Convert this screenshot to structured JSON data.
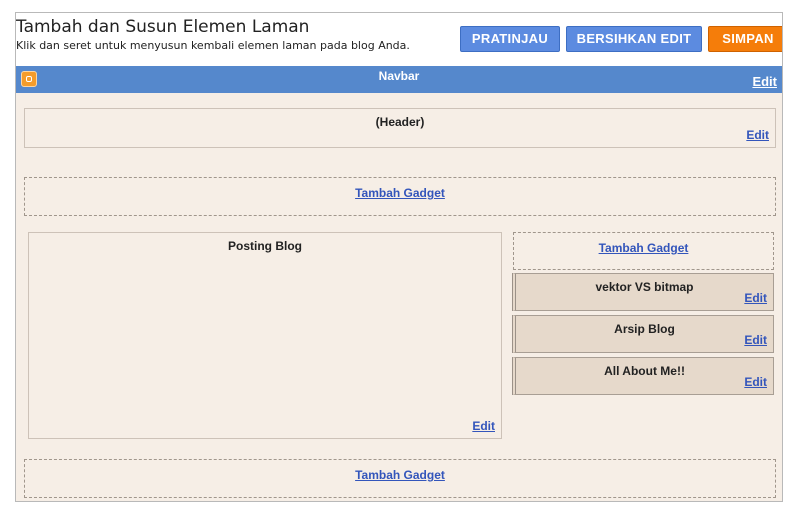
{
  "header": {
    "title": "Tambah dan Susun Elemen Laman",
    "subtitle": "Klik dan seret untuk menyusun kembali elemen laman pada blog Anda."
  },
  "toolbar": {
    "preview_label": "PRATINJAU",
    "clear_label": "BERSIHKAN EDIT",
    "save_label": "SIMPAN"
  },
  "navbar": {
    "title": "Navbar",
    "edit_label": "Edit"
  },
  "layout": {
    "header_widget": {
      "title": "(Header)",
      "edit_label": "Edit"
    },
    "add_gadget_top": "Tambah Gadget",
    "main_column": {
      "title": "Posting Blog",
      "edit_label": "Edit"
    },
    "sidebar": {
      "add_gadget": "Tambah Gadget",
      "gadgets": [
        {
          "title": "vektor VS bitmap",
          "edit_label": "Edit"
        },
        {
          "title": "Arsip Blog",
          "edit_label": "Edit"
        },
        {
          "title": "All About Me!!",
          "edit_label": "Edit"
        }
      ]
    },
    "add_gadget_bottom": "Tambah Gadget"
  },
  "colors": {
    "navbar_bg": "#5588cc",
    "canvas_bg": "#f6eee6",
    "button_blue": "#5c8be0",
    "button_orange": "#f57d0a",
    "link": "#3355bb"
  }
}
